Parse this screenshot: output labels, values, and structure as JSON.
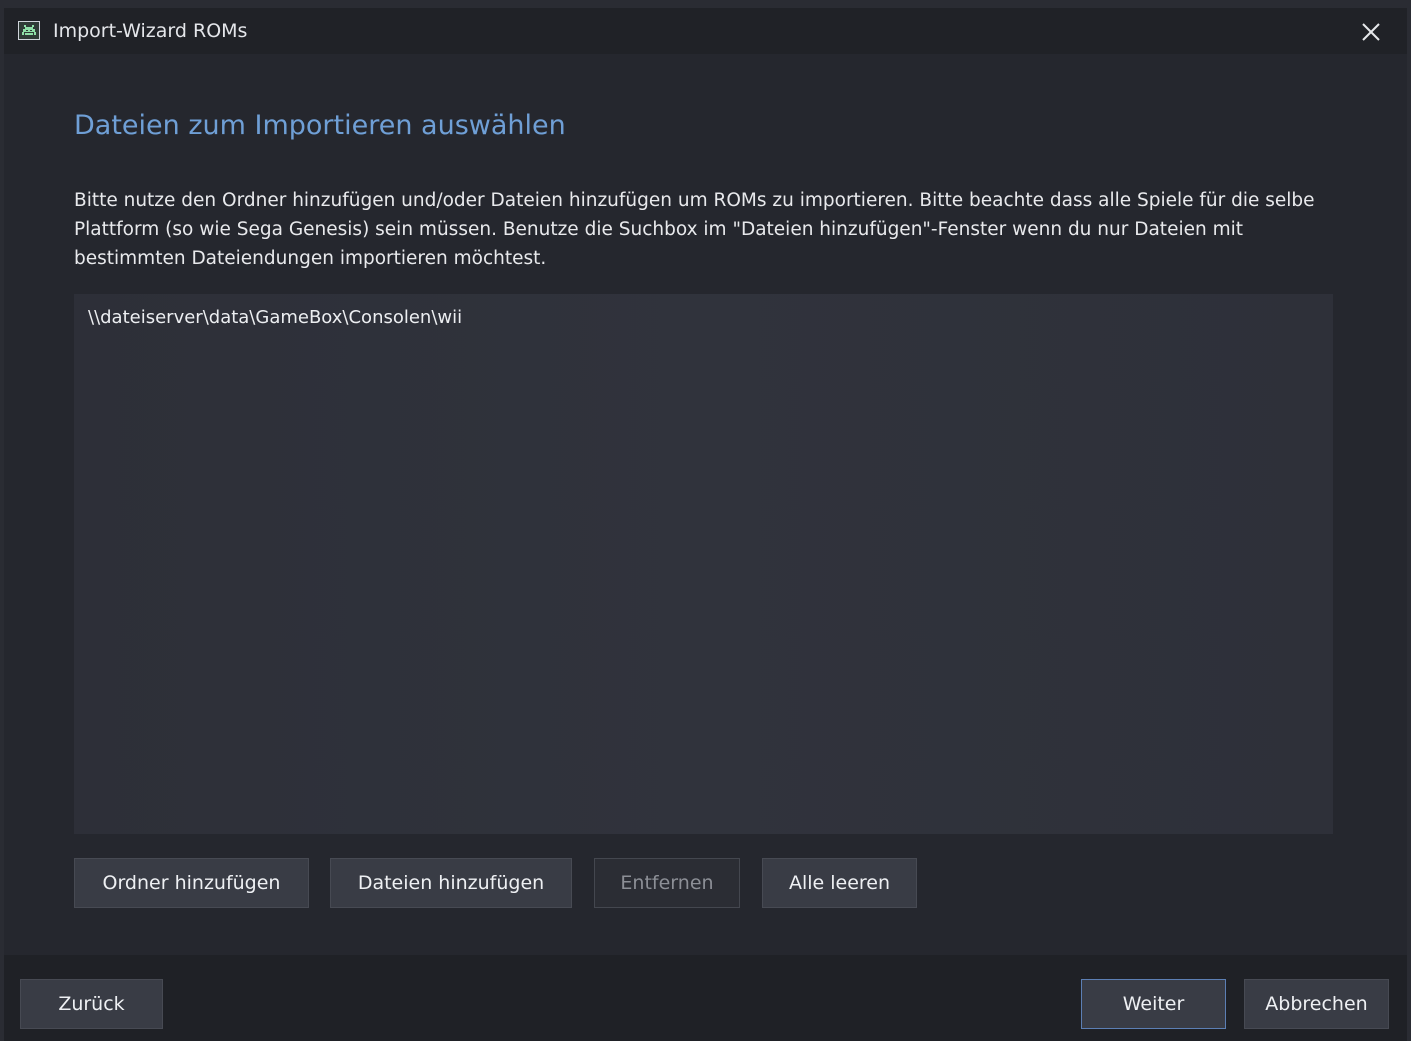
{
  "window": {
    "title": "Import-Wizard ROMs",
    "icon": "space-invader-icon"
  },
  "main": {
    "heading": "Dateien zum Importieren auswählen",
    "description": "Bitte nutze den Ordner hinzufügen und/oder Dateien hinzufügen um ROMs zu importieren. Bitte beachte dass alle Spiele für die selbe Plattform (so wie Sega Genesis) sein müssen. Benutze die Suchbox im \"Dateien hinzufügen\"-Fenster wenn du nur Dateien mit bestimmten Dateiendungen importieren möchtest.",
    "files": [
      "\\\\dateiserver\\data\\GameBox\\Consolen\\wii"
    ],
    "buttons": {
      "add_folder": "Ordner hinzufügen",
      "add_files": "Dateien hinzufügen",
      "remove": "Entfernen",
      "clear_all": "Alle leeren"
    }
  },
  "footer": {
    "back": "Zurück",
    "next": "Weiter",
    "cancel": "Abbrechen"
  },
  "colors": {
    "heading": "#6f9fd6",
    "background": "#25272e",
    "primary_border": "#5c7fb4"
  }
}
